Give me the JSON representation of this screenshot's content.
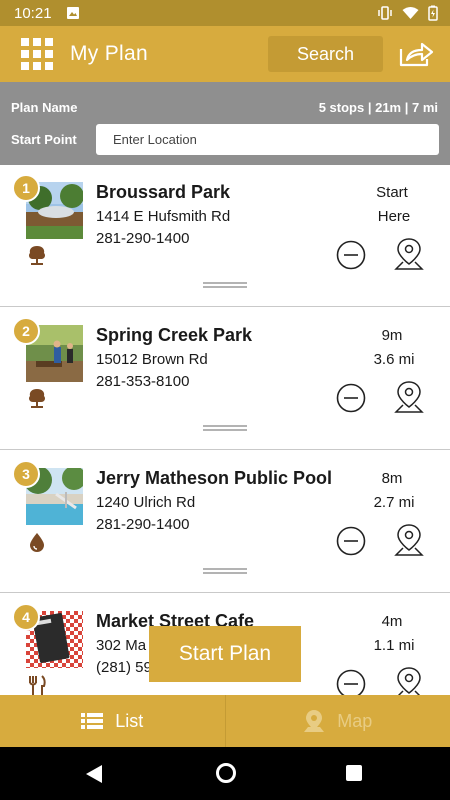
{
  "status": {
    "time": "10:21"
  },
  "appbar": {
    "title": "My Plan",
    "search_label": "Search",
    "menu_icon": "grid-menu-icon",
    "share_icon": "share-icon"
  },
  "plan": {
    "name_label": "Plan Name",
    "summary": "5 stops | 21m | 7 mi",
    "start_label": "Start Point",
    "start_placeholder": "Enter Location",
    "start_value": ""
  },
  "stops": [
    {
      "number": "1",
      "name": "Broussard Park",
      "address": "1414 E Hufsmith Rd",
      "phone": "281-290-1400",
      "time": "Start",
      "distance": "Here",
      "category_icon": "tree-icon"
    },
    {
      "number": "2",
      "name": "Spring Creek Park",
      "address": "15012 Brown Rd",
      "phone": "281-353-8100",
      "time": "9m",
      "distance": "3.6 mi",
      "category_icon": "tree-icon"
    },
    {
      "number": "3",
      "name": "Jerry Matheson Public Pool",
      "address": "1240 Ulrich Rd",
      "phone": "281-290-1400",
      "time": "8m",
      "distance": "2.7 mi",
      "category_icon": "water-drop-icon"
    },
    {
      "number": "4",
      "name": "Market Street Cafe",
      "address": "302 Ma",
      "phone": "(281) 59",
      "time": "4m",
      "distance": "1.1 mi",
      "category_icon": "fork-knife-icon"
    }
  ],
  "start_plan_label": "Start Plan",
  "tabs": {
    "list_label": "List",
    "map_label": "Map"
  },
  "colors": {
    "accent": "#d7ab3e",
    "status_bar": "#b08f2e",
    "plan_header": "#8f8f8f"
  }
}
